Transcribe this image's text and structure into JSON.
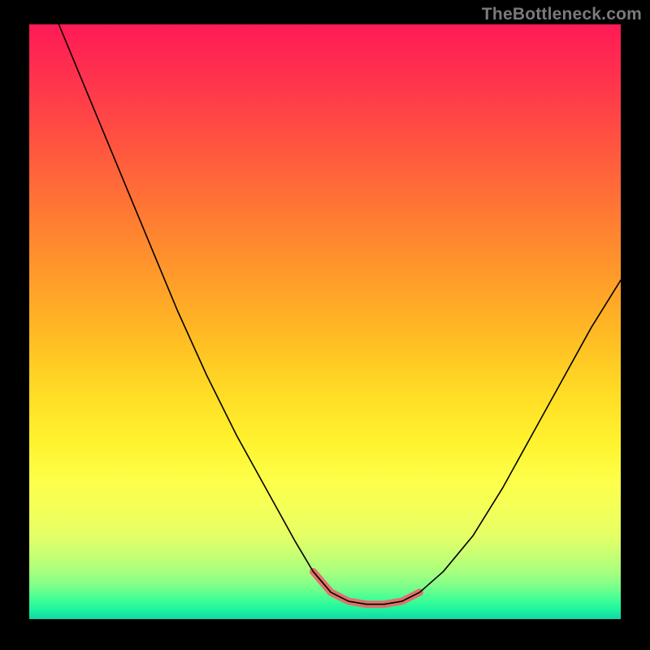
{
  "watermark": "TheBottleneck.com",
  "colors": {
    "curve": "#000000",
    "highlight": "#e86a6a"
  },
  "chart_data": {
    "type": "line",
    "title": "",
    "xlabel": "",
    "ylabel": "",
    "xlim": [
      0,
      100
    ],
    "ylim": [
      0,
      100
    ],
    "series": [
      {
        "name": "curve",
        "x": [
          5,
          10,
          15,
          20,
          25,
          30,
          35,
          40,
          45,
          48,
          51,
          54,
          57,
          60,
          63,
          66,
          70,
          75,
          80,
          85,
          90,
          95,
          100
        ],
        "y": [
          100,
          88,
          76,
          64,
          52,
          41,
          31,
          22,
          13,
          8,
          4.5,
          3,
          2.5,
          2.5,
          3,
          4.5,
          8,
          14,
          22,
          31,
          40,
          49,
          57
        ]
      }
    ],
    "highlight_segment": {
      "name": "trough-accent",
      "x": [
        48,
        51,
        54,
        57,
        60,
        63,
        66
      ],
      "y": [
        8,
        4.5,
        3,
        2.5,
        2.5,
        3,
        4.5
      ]
    }
  }
}
